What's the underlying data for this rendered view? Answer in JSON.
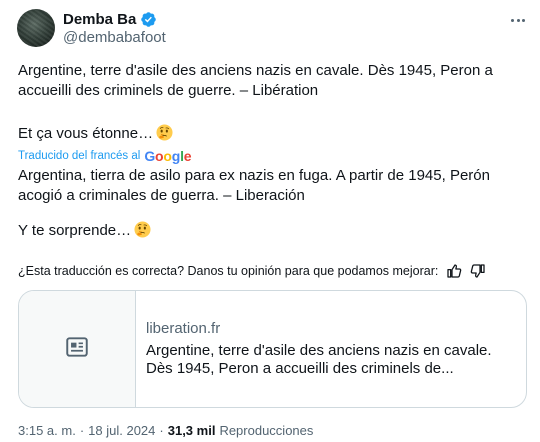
{
  "author": {
    "display_name": "Demba Ba",
    "handle": "@dembabafoot",
    "verified": true,
    "verified_color": "#1d9bf0"
  },
  "original_text": {
    "line1": "Argentine, terre d'asile des anciens nazis en cavale. Dès 1945, Peron a accueilli des criminels de guerre. – Libération",
    "line2": "Et ça vous étonne…",
    "emoji": "thinking-face"
  },
  "translation": {
    "label": "Traducido del francés al",
    "provider": "Google",
    "line1": "Argentina, tierra de asilo para ex nazis en fuga. A partir de 1945, Perón acogió a criminales de guerra. – Liberación",
    "line2": "Y te sorprende…",
    "emoji": "thinking-face"
  },
  "feedback": {
    "question": "¿Esta traducción es correcta? Danos tu opinión para que podamos mejorar:",
    "like_icon": "thumbs-up-icon",
    "dislike_icon": "thumbs-down-icon"
  },
  "link_card": {
    "icon": "article-icon",
    "domain": "liberation.fr",
    "title": "Argentine, terre d'asile des anciens nazis en cavale. Dès 1945, Peron a accueilli des criminels de..."
  },
  "meta": {
    "time": "3:15 a. m.",
    "separator": "·",
    "date": "18 jul. 2024",
    "views_count": "31,3 mil",
    "views_label": "Reproducciones"
  },
  "colors": {
    "text": "#0f1419",
    "secondary": "#536471",
    "accent": "#1d9bf0",
    "border": "#cfd9de"
  }
}
